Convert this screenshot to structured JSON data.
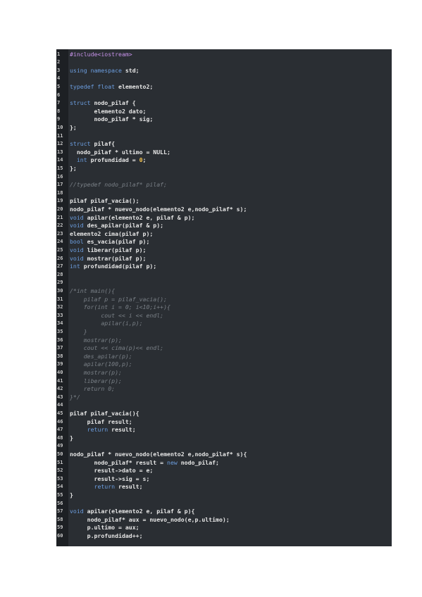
{
  "colors": {
    "editor_background": "#2a2e33",
    "gutter_background": "#1d2024",
    "text": "#e6e6e6",
    "keyword": "#6c9ee0",
    "preprocessor": "#c792ea",
    "number": "#f2c14e",
    "comment": "#7a8087"
  },
  "lines": [
    {
      "n": "1",
      "segs": [
        {
          "t": "#include<iostream>",
          "c": "pp"
        }
      ]
    },
    {
      "n": "2",
      "segs": []
    },
    {
      "n": "3",
      "segs": [
        {
          "t": "using namespace",
          "c": "kw"
        },
        {
          "t": " std;"
        }
      ]
    },
    {
      "n": "4",
      "segs": []
    },
    {
      "n": "5",
      "segs": [
        {
          "t": "typedef float",
          "c": "kw"
        },
        {
          "t": " elemento2;"
        }
      ]
    },
    {
      "n": "6",
      "segs": []
    },
    {
      "n": "7",
      "segs": [
        {
          "t": "struct",
          "c": "kw"
        },
        {
          "t": " nodo_pilaf {"
        }
      ]
    },
    {
      "n": "8",
      "segs": [
        {
          "t": "       elemento2 dato;"
        }
      ]
    },
    {
      "n": "9",
      "segs": [
        {
          "t": "       nodo_pilaf * sig;"
        }
      ]
    },
    {
      "n": "10",
      "segs": [
        {
          "t": "};"
        }
      ]
    },
    {
      "n": "11",
      "segs": []
    },
    {
      "n": "12",
      "segs": [
        {
          "t": "struct",
          "c": "kw"
        },
        {
          "t": " pilaf{"
        }
      ]
    },
    {
      "n": "13",
      "segs": [
        {
          "t": "  nodo_pilaf * ultimo = NULL;"
        }
      ]
    },
    {
      "n": "14",
      "segs": [
        {
          "t": "  "
        },
        {
          "t": "int",
          "c": "kw"
        },
        {
          "t": " profundidad = "
        },
        {
          "t": "0",
          "c": "num"
        },
        {
          "t": ";"
        }
      ]
    },
    {
      "n": "15",
      "segs": [
        {
          "t": "};"
        }
      ]
    },
    {
      "n": "16",
      "segs": []
    },
    {
      "n": "17",
      "segs": [
        {
          "t": "//typedef nodo_pilaf* pilaf;",
          "c": "cm"
        }
      ]
    },
    {
      "n": "18",
      "segs": []
    },
    {
      "n": "19",
      "segs": [
        {
          "t": "pilaf pilaf_vacia();"
        }
      ]
    },
    {
      "n": "20",
      "segs": [
        {
          "t": "nodo_pilaf * nuevo_nodo(elemento2 e,nodo_pilaf* s);"
        }
      ]
    },
    {
      "n": "21",
      "segs": [
        {
          "t": "void",
          "c": "kw"
        },
        {
          "t": " apilar(elemento2 e, pilaf & p);"
        }
      ]
    },
    {
      "n": "22",
      "segs": [
        {
          "t": "void",
          "c": "kw"
        },
        {
          "t": " des_apilar(pilaf & p);"
        }
      ]
    },
    {
      "n": "23",
      "segs": [
        {
          "t": "elemento2 cima(pilaf p);"
        }
      ]
    },
    {
      "n": "24",
      "segs": [
        {
          "t": "bool",
          "c": "kw"
        },
        {
          "t": " es_vacia(pilaf p);"
        }
      ]
    },
    {
      "n": "25",
      "segs": [
        {
          "t": "void",
          "c": "kw"
        },
        {
          "t": " liberar(pilaf p);"
        }
      ]
    },
    {
      "n": "26",
      "segs": [
        {
          "t": "void",
          "c": "kw"
        },
        {
          "t": " mostrar(pilaf p);"
        }
      ]
    },
    {
      "n": "27",
      "segs": [
        {
          "t": "int",
          "c": "kw"
        },
        {
          "t": " profundidad(pilaf p);"
        }
      ]
    },
    {
      "n": "28",
      "segs": []
    },
    {
      "n": "29",
      "segs": []
    },
    {
      "n": "30",
      "segs": [
        {
          "t": "/*int main(){",
          "c": "cm"
        }
      ]
    },
    {
      "n": "31",
      "segs": [
        {
          "t": "    pilaf p = pilaf_vacia();",
          "c": "cm"
        }
      ]
    },
    {
      "n": "32",
      "segs": [
        {
          "t": "    for(int i = 0; i<10;i++){",
          "c": "cm"
        }
      ]
    },
    {
      "n": "33",
      "segs": [
        {
          "t": "         cout << i << endl;",
          "c": "cm"
        }
      ]
    },
    {
      "n": "34",
      "segs": [
        {
          "t": "         apilar(i,p);",
          "c": "cm"
        }
      ]
    },
    {
      "n": "35",
      "segs": [
        {
          "t": "    }",
          "c": "cm"
        }
      ]
    },
    {
      "n": "36",
      "segs": [
        {
          "t": "    mostrar(p);",
          "c": "cm"
        }
      ]
    },
    {
      "n": "37",
      "segs": [
        {
          "t": "    cout << cima(p)<< endl;",
          "c": "cm"
        }
      ]
    },
    {
      "n": "38",
      "segs": [
        {
          "t": "    des_apilar(p);",
          "c": "cm"
        }
      ]
    },
    {
      "n": "39",
      "segs": [
        {
          "t": "    apilar(100,p);",
          "c": "cm"
        }
      ]
    },
    {
      "n": "40",
      "segs": [
        {
          "t": "    mostrar(p);",
          "c": "cm"
        }
      ]
    },
    {
      "n": "41",
      "segs": [
        {
          "t": "    liberar(p);",
          "c": "cm"
        }
      ]
    },
    {
      "n": "42",
      "segs": [
        {
          "t": "    return 0;",
          "c": "cm"
        }
      ]
    },
    {
      "n": "43",
      "segs": [
        {
          "t": "}*/",
          "c": "cm"
        }
      ]
    },
    {
      "n": "44",
      "segs": []
    },
    {
      "n": "45",
      "segs": [
        {
          "t": "pilaf pilaf_vacia(){"
        }
      ]
    },
    {
      "n": "46",
      "segs": [
        {
          "t": "     pilaf result;"
        }
      ]
    },
    {
      "n": "47",
      "segs": [
        {
          "t": "     "
        },
        {
          "t": "return",
          "c": "kw"
        },
        {
          "t": " result;"
        }
      ]
    },
    {
      "n": "48",
      "segs": [
        {
          "t": "}"
        }
      ]
    },
    {
      "n": "49",
      "segs": []
    },
    {
      "n": "50",
      "segs": [
        {
          "t": "nodo_pilaf * nuevo_nodo(elemento2 e,nodo_pilaf* s){"
        }
      ]
    },
    {
      "n": "51",
      "segs": [
        {
          "t": "       nodo_pilaf* result = "
        },
        {
          "t": "new",
          "c": "kw"
        },
        {
          "t": " nodo_pilaf;"
        }
      ]
    },
    {
      "n": "52",
      "segs": [
        {
          "t": "       result->dato = e;"
        }
      ]
    },
    {
      "n": "53",
      "segs": [
        {
          "t": "       result->sig = s;"
        }
      ]
    },
    {
      "n": "54",
      "segs": [
        {
          "t": "       "
        },
        {
          "t": "return",
          "c": "kw"
        },
        {
          "t": " result;"
        }
      ]
    },
    {
      "n": "55",
      "segs": [
        {
          "t": "}"
        }
      ]
    },
    {
      "n": "56",
      "segs": []
    },
    {
      "n": "57",
      "segs": [
        {
          "t": "void",
          "c": "kw"
        },
        {
          "t": " apilar(elemento2 e, pilaf & p){"
        }
      ]
    },
    {
      "n": "58",
      "segs": [
        {
          "t": "     nodo_pilaf* aux = nuevo_nodo(e,p.ultimo);"
        }
      ]
    },
    {
      "n": "59",
      "segs": [
        {
          "t": "     p.ultimo = aux;"
        }
      ]
    },
    {
      "n": "60",
      "segs": [
        {
          "t": "     p.profundidad++;"
        }
      ]
    }
  ]
}
